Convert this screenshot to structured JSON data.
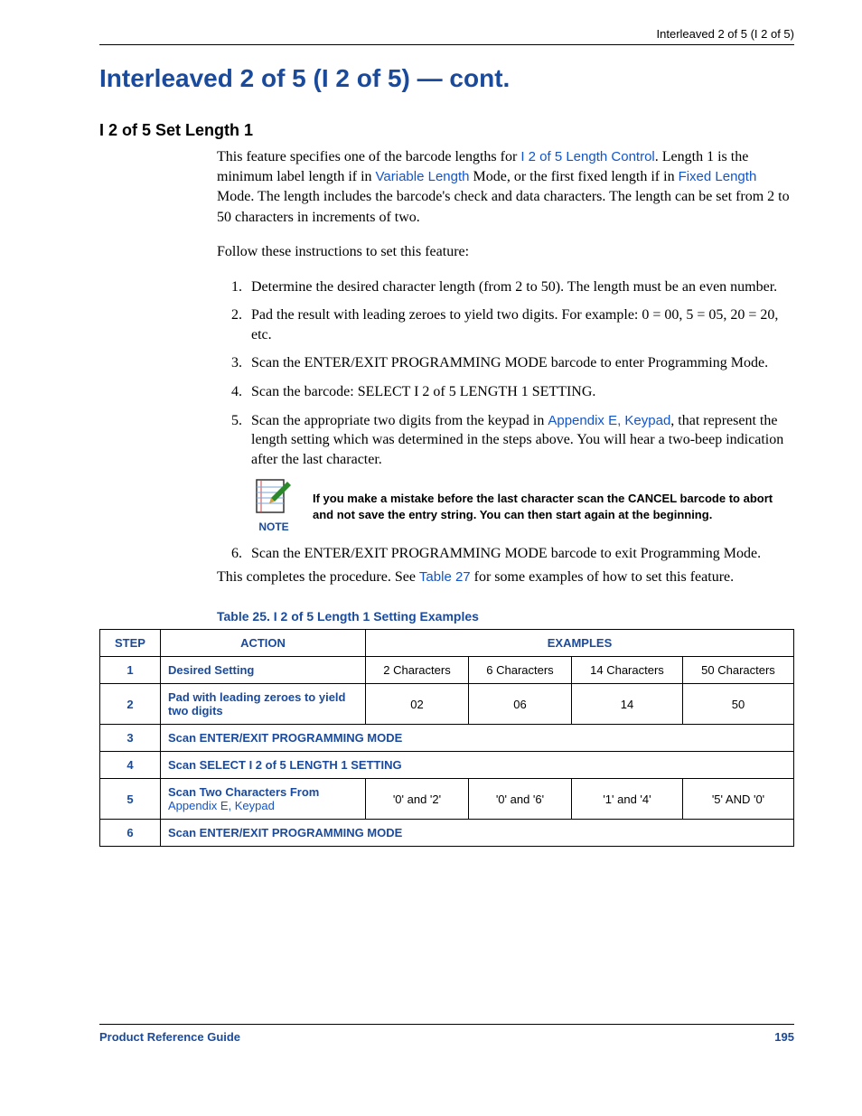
{
  "header": {
    "running": "Interleaved 2 of 5 (I 2 of 5)"
  },
  "titles": {
    "h1": "Interleaved 2 of 5 (I 2 of 5) — cont.",
    "h2": "I 2 of 5 Set Length 1"
  },
  "intro": {
    "p1a": "This feature specifies one of the barcode lengths for ",
    "link1": "I 2 of 5 Length Control",
    "p1b": ". Length 1 is the minimum label length if in ",
    "link2": "Variable Length",
    "p1c": " Mode, or the first fixed length if in ",
    "link3": "Fixed Length",
    "p1d": " Mode. The length includes the barcode's check and data characters. The length can be set from 2 to 50 characters in increments of two.",
    "p2": "Follow these instructions to set this feature:"
  },
  "steps": {
    "s1": "Determine the desired character length (from 2 to 50). The length must be an even number.",
    "s2": "Pad the result with leading zeroes to yield two digits. For example: 0 = 00, 5 = 05, 20 = 20, etc.",
    "s3": "Scan the ENTER/EXIT PROGRAMMING MODE barcode to enter Programming Mode.",
    "s4": "Scan the barcode: SELECT I 2 of 5 LENGTH 1 SETTING.",
    "s5a": "Scan the appropriate two digits from the keypad in ",
    "s5link": "Appendix E, Keypad",
    "s5b": ", that represent the length setting which was determined in the steps above. You will hear a two-beep indication after the last character.",
    "s6": "Scan the ENTER/EXIT PROGRAMMING MODE barcode to exit Programming Mode."
  },
  "note": {
    "label": "NOTE",
    "text": "If you make a mistake before the last character scan the CANCEL barcode to abort and not save the entry string. You can then start again at the beginning."
  },
  "closing": {
    "pa": "This completes the procedure. See ",
    "link": "Table 27",
    "pb": " for some examples of how to set this feature."
  },
  "table": {
    "caption": "Table 25. I 2 of 5 Length 1 Setting Examples",
    "headers": {
      "step": "STEP",
      "action": "ACTION",
      "examples": "EXAMPLES"
    },
    "rows": {
      "r1": {
        "step": "1",
        "action": "Desired Setting",
        "c1": "2 Characters",
        "c2": "6 Characters",
        "c3": "14 Characters",
        "c4": "50 Characters"
      },
      "r2": {
        "step": "2",
        "action": "Pad with leading zeroes to yield two digits",
        "c1": "02",
        "c2": "06",
        "c3": "14",
        "c4": "50"
      },
      "r3": {
        "step": "3",
        "action": "Scan ENTER/EXIT PROGRAMMING MODE"
      },
      "r4": {
        "step": "4",
        "action": "Scan SELECT I 2 of 5 LENGTH 1 SETTING"
      },
      "r5": {
        "step": "5",
        "action_a": "Scan Two Characters From ",
        "action_link": "Appendix E, Keypad",
        "c1": "'0' and '2'",
        "c2": "'0' and '6'",
        "c3": "'1' and '4'",
        "c4": "'5' AND '0'"
      },
      "r6": {
        "step": "6",
        "action": "Scan ENTER/EXIT PROGRAMMING MODE"
      }
    }
  },
  "footer": {
    "left": "Product Reference Guide",
    "right": "195"
  }
}
